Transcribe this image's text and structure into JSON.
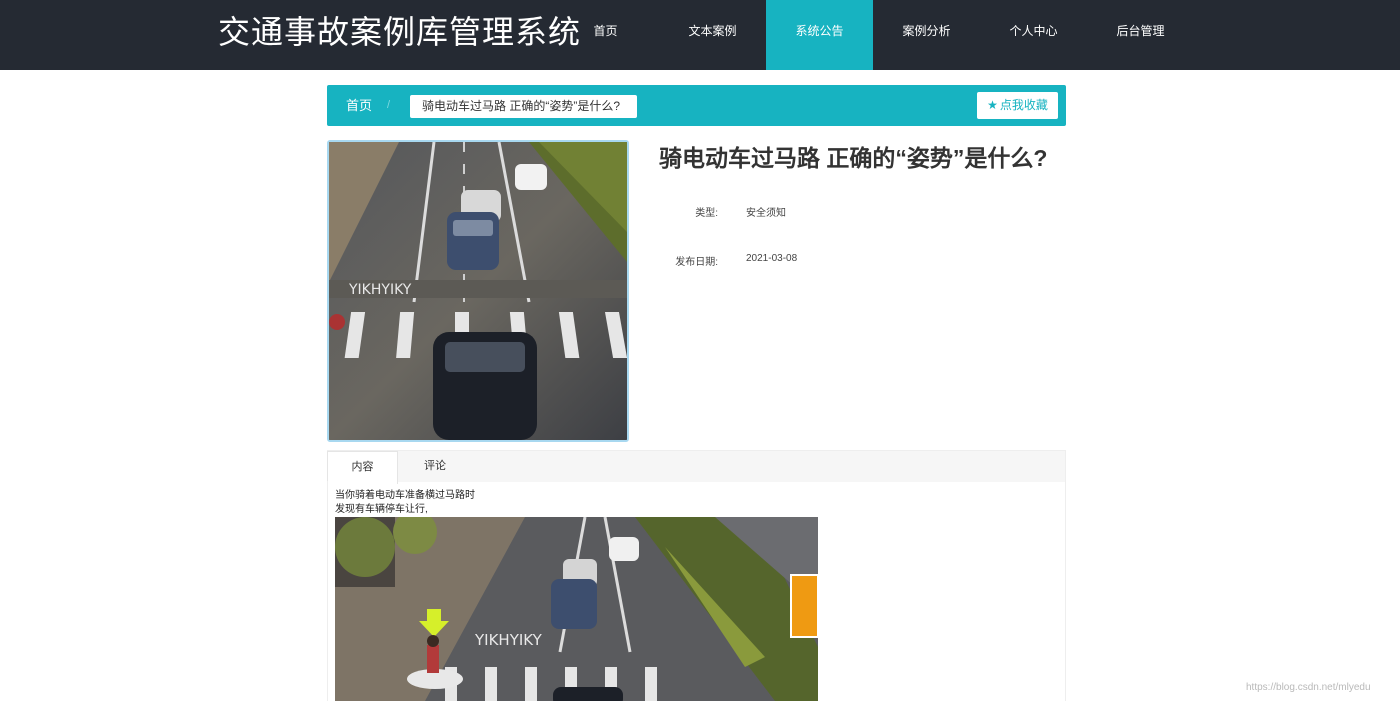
{
  "header": {
    "title": "交通事故案例库管理系统",
    "nav": [
      "首页",
      "文本案例",
      "系统公告",
      "案例分析",
      "个人中心",
      "后台管理"
    ],
    "active_index": 2,
    "accent": "#17b3c1",
    "background": "#252a33"
  },
  "breadcrumb": {
    "home": "首页",
    "separator": "/",
    "current": "骑电动车过马路 正确的“姿势”是什么?",
    "favorite_label": "点我收藏",
    "favorite_icon": "star-icon"
  },
  "article": {
    "title": "骑电动车过马路 正确的“姿势”是什么?",
    "type_label": "类型:",
    "type_value": "安全须知",
    "date_label": "发布日期:",
    "date_value": "2021-03-08"
  },
  "tabs": {
    "items": [
      "内容",
      "评论"
    ],
    "active_index": 0
  },
  "content": {
    "line1": "当你骑着电动车准备横过马路时",
    "line2": "发现有车辆停车让行,"
  },
  "watermark": "https://blog.csdn.net/mlyedu"
}
